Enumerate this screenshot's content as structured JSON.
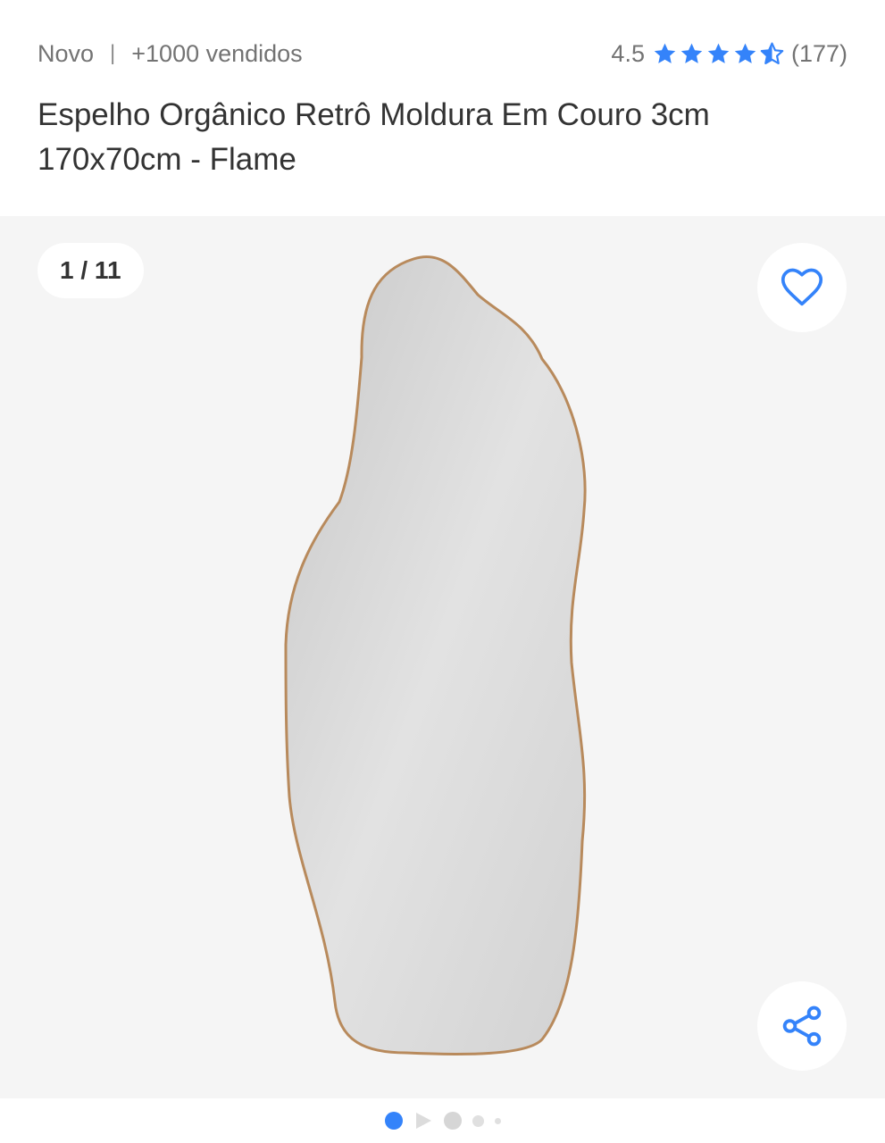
{
  "product": {
    "condition": "Novo",
    "separator": "|",
    "sold": "+1000 vendidos",
    "rating": "4.5",
    "reviews": "(177)",
    "stars": 4.5,
    "title": "Espelho Orgânico Retrô Moldura Em Couro 3cm 170x70cm - Flame"
  },
  "gallery": {
    "counter": "1 / 11",
    "current_index": 1,
    "total": 11,
    "favorite_icon": "heart-icon",
    "share_icon": "share-icon"
  },
  "colors": {
    "accent": "#3483fa",
    "gallery_bg": "#f5f5f5",
    "frame": "#b88a5c"
  }
}
